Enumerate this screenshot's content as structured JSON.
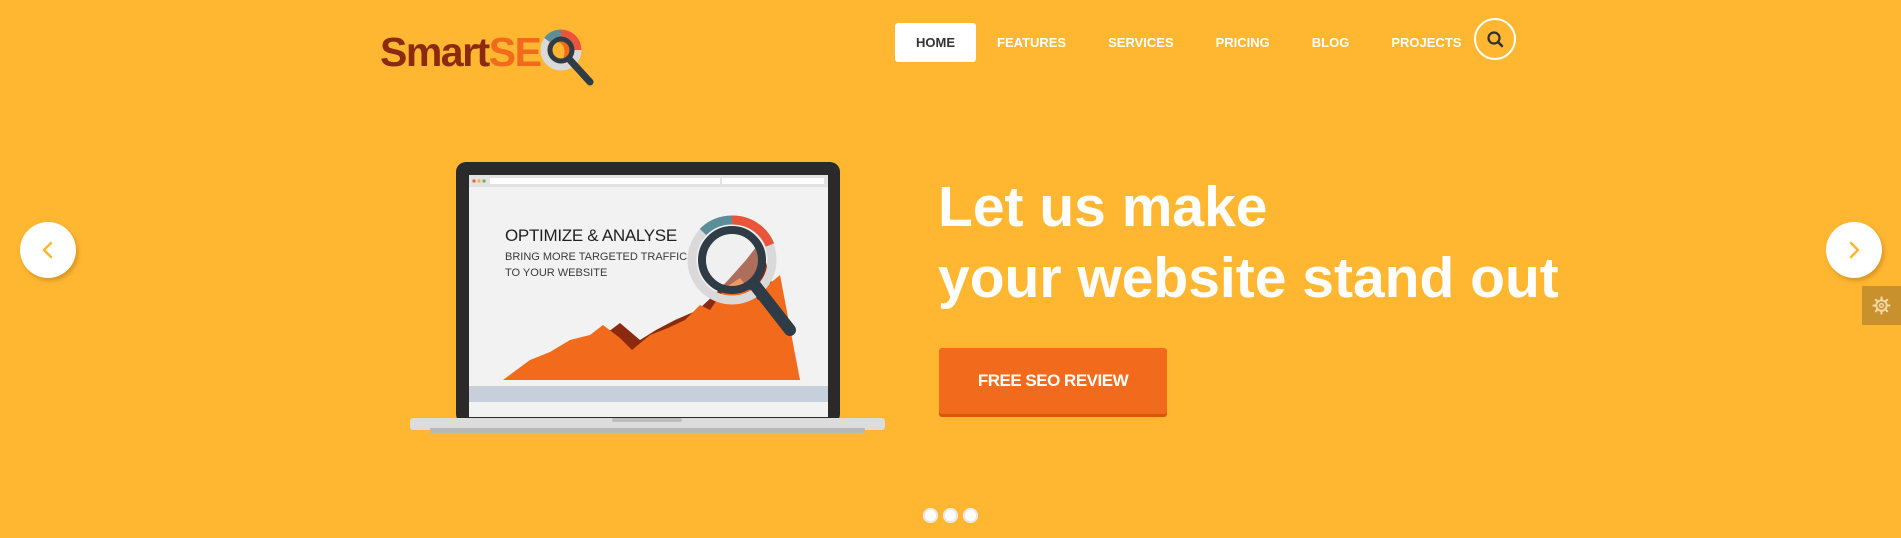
{
  "brand": {
    "logo_part1": "Smart",
    "logo_part2": "SEO",
    "colors": {
      "dark": "#8B2A0E",
      "accent": "#F26A1B",
      "background": "#FFB732"
    }
  },
  "nav": {
    "items": [
      {
        "label": "HOME",
        "active": true
      },
      {
        "label": "FEATURES",
        "active": false
      },
      {
        "label": "SERVICES",
        "active": false
      },
      {
        "label": "PRICING",
        "active": false
      },
      {
        "label": "BLOG",
        "active": false
      },
      {
        "label": "PROJECTS",
        "active": false
      }
    ],
    "search_icon": "search-icon"
  },
  "hero": {
    "title_line1": "Let us make",
    "title_line2": "your website stand out",
    "cta_label": "FREE SEO REVIEW",
    "screen_title": "OPTIMIZE & ANALYSE",
    "screen_subtitle_line1": "BRING MORE TARGETED TRAFFIC",
    "screen_subtitle_line2": "TO YOUR WEBSITE"
  },
  "slider": {
    "prev_icon": "chevron-left-icon",
    "next_icon": "chevron-right-icon",
    "dot_count": 3
  },
  "settings_icon": "gear-icon"
}
